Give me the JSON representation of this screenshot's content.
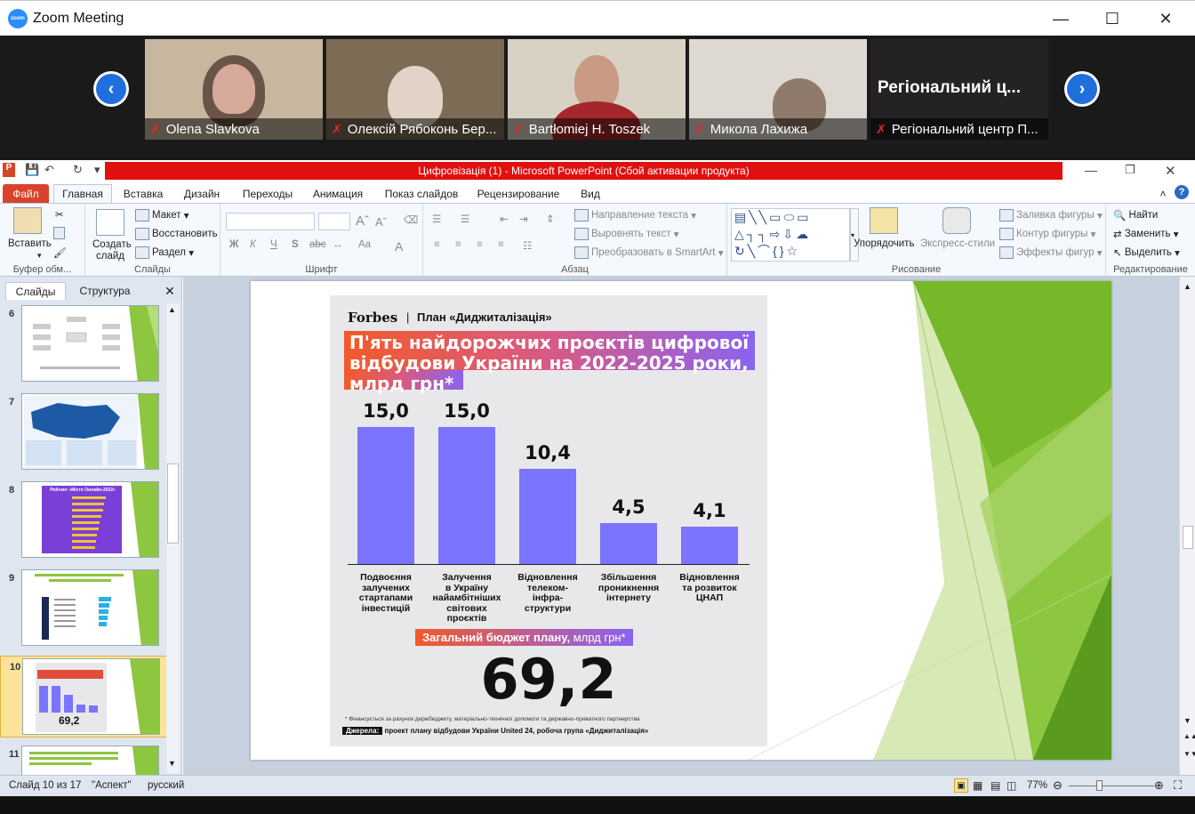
{
  "zoom": {
    "window_title": "Zoom Meeting",
    "participants": [
      {
        "name": "Olena Slavkova"
      },
      {
        "name": "Олексій Рябоконь Бер..."
      },
      {
        "name": "Bartłomiej H. Toszek"
      },
      {
        "name": "Микола Лахижа"
      },
      {
        "name": "Регіональний центр П...",
        "tile_text": "Регіональний ц..."
      }
    ]
  },
  "powerpoint": {
    "title": "Цифровізація (1)  -  Microsoft PowerPoint (Сбой активации продукта)",
    "tabs": [
      "Файл",
      "Главная",
      "Вставка",
      "Дизайн",
      "Переходы",
      "Анимация",
      "Показ слайдов",
      "Рецензирование",
      "Вид"
    ],
    "ribbon": {
      "clipboard": {
        "label": "Буфер обм...",
        "paste": "Вставить"
      },
      "slides": {
        "label": "Слайды",
        "new_slide_1": "Создать",
        "new_slide_2": "слайд",
        "layout": "Макет",
        "reset": "Восстановить",
        "section": "Раздел"
      },
      "font": {
        "label": "Шрифт",
        "bold": "Ж",
        "italic": "К",
        "underline": "Ч",
        "strike": "abc",
        "case": "Aa"
      },
      "paragraph": {
        "label": "Абзац",
        "direction": "Направление текста",
        "align_text": "Выровнять текст",
        "smartart": "Преобразовать в SmartArt"
      },
      "drawing": {
        "label": "Рисование",
        "arrange": "Упорядочить",
        "quick_styles": "Экспресс-стили",
        "fill": "Заливка фигуры",
        "outline": "Контур фигуры",
        "effects": "Эффекты фигур"
      },
      "editing": {
        "label": "Редактирование",
        "find": "Найти",
        "replace": "Заменить",
        "select": "Выделить"
      }
    },
    "pane": {
      "tab_slides": "Слайды",
      "tab_outline": "Структура",
      "thumbnails": [
        {
          "num": "6"
        },
        {
          "num": "7"
        },
        {
          "num": "8",
          "title": "Рейтинг «Місто Онлайн-2022»"
        },
        {
          "num": "9"
        },
        {
          "num": "10",
          "value": "69,2"
        },
        {
          "num": "11"
        }
      ]
    },
    "status": {
      "slide": "Слайд 10 из 17",
      "theme": "\"Аспект\"",
      "language": "русский",
      "zoom": "77%"
    }
  },
  "slide": {
    "brand": "Forbes",
    "plan": "План «Диджиталізація»",
    "headline": "П'ять найдорожчих проєктів цифрової відбудови України на 2022-2025 роки, млрд грн*",
    "budget_label": "Загальний бюджет плану,",
    "budget_unit": "млрд грн*",
    "total": "69,2",
    "footnote": "* Фінансується за рахунок держбюджету, матеріально-технічної допомоги та державно-приватного партнерства",
    "sources_label": "Джерела:",
    "sources_text": "проект плану відбудови України United 24, робоча група «Диджиталізація»"
  },
  "chart_data": {
    "type": "bar",
    "categories": [
      "Подвоєння залучених стартапами інвестицій",
      "Залучення в Україну найамбітніших світових проєктів",
      "Відновлення телеком-інфра-структури",
      "Збільшення проникнення інтернету",
      "Відновлення та розвиток ЦНАП"
    ],
    "category_lines": [
      [
        "Подвоєння",
        "залучених",
        "стартапами",
        "інвестицій"
      ],
      [
        "Залучення",
        "в Україну",
        "найамбітніших",
        "світових",
        "проєктів"
      ],
      [
        "Відновлення",
        "телеком-",
        "інфра-",
        "структури"
      ],
      [
        "Збільшення",
        "проникнення",
        "інтернету"
      ],
      [
        "Відновлення",
        "та розвиток",
        "ЦНАП"
      ]
    ],
    "values": [
      15.0,
      15.0,
      10.4,
      4.5,
      4.1
    ],
    "value_labels": [
      "15,0",
      "15,0",
      "10,4",
      "4,5",
      "4,1"
    ],
    "title": "П'ять найдорожчих проєктів цифрової відбудови України на 2022-2025 роки, млрд грн*",
    "ylim": [
      0,
      15
    ],
    "grid": false,
    "colors": {
      "bar": "#7b74ff"
    }
  },
  "colors": {
    "accent_red": "#e11010",
    "file_tab": "#d9432b",
    "zoom_blue": "#2d8cff",
    "green": "#8dc63f"
  }
}
